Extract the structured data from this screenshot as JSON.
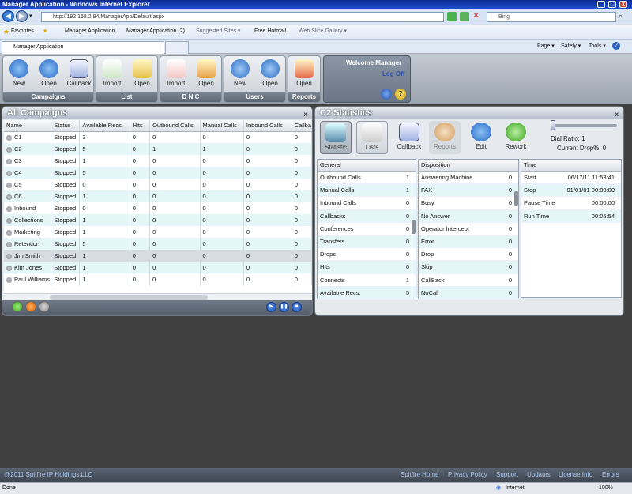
{
  "window": {
    "title": "Manager Application - Windows Internet Explorer"
  },
  "browser": {
    "url": "http://192.168.2.94/ManagerApp/Default.aspx",
    "search_placeholder": "Bing",
    "favorites": {
      "label": "Favorites",
      "items": [
        "Manager Application",
        "Manager Application (2)",
        "Suggested Sites ▾",
        "Free Hotmail",
        "Web Slice Gallery ▾"
      ]
    },
    "tab": "Manager Application",
    "commands": [
      "Page ▾",
      "Safety ▾",
      "Tools ▾"
    ]
  },
  "toolbar": {
    "groups": [
      {
        "label": "Campaigns",
        "buttons": [
          "New",
          "Open",
          "Callback"
        ]
      },
      {
        "label": "List",
        "buttons": [
          "Import",
          "Open"
        ]
      },
      {
        "label": "D N C",
        "buttons": [
          "Import",
          "Open"
        ]
      },
      {
        "label": "Users",
        "buttons": [
          "New",
          "Open"
        ]
      },
      {
        "label": "Reports",
        "buttons": [
          "Open"
        ]
      }
    ],
    "welcome": "Welcome Manager",
    "logoff": "Log Off"
  },
  "campaigns": {
    "title": "All Campaigns",
    "columns": [
      "Name",
      "Status",
      "Available Recs.",
      "Hits",
      "Outbound Calls",
      "Manual Calls",
      "Inbound Calls",
      "Callba"
    ],
    "rows": [
      [
        "C1",
        "Stopped",
        "3",
        "0",
        "0",
        "0",
        "0",
        "0"
      ],
      [
        "C2",
        "Stopped",
        "5",
        "0",
        "1",
        "1",
        "0",
        "0"
      ],
      [
        "C3",
        "Stopped",
        "1",
        "0",
        "0",
        "0",
        "0",
        "0"
      ],
      [
        "C4",
        "Stopped",
        "5",
        "0",
        "0",
        "0",
        "0",
        "0"
      ],
      [
        "C5",
        "Stopped",
        "0",
        "0",
        "0",
        "0",
        "0",
        "0"
      ],
      [
        "C6",
        "Stopped",
        "1",
        "0",
        "0",
        "0",
        "0",
        "0"
      ],
      [
        "Inbound",
        "Stopped",
        "0",
        "0",
        "0",
        "0",
        "0",
        "0"
      ],
      [
        "Collections",
        "Stopped",
        "1",
        "0",
        "0",
        "0",
        "0",
        "0"
      ],
      [
        "Marketing",
        "Stopped",
        "1",
        "0",
        "0",
        "0",
        "0",
        "0"
      ],
      [
        "Retention",
        "Stopped",
        "5",
        "0",
        "0",
        "0",
        "0",
        "0"
      ],
      [
        "Jim Smith",
        "Stopped",
        "1",
        "0",
        "0",
        "0",
        "0",
        "0"
      ],
      [
        "Kim Jones",
        "Stopped",
        "1",
        "0",
        "0",
        "0",
        "0",
        "0"
      ],
      [
        "Paul Williams",
        "Stopped",
        "1",
        "0",
        "0",
        "0",
        "0",
        "0"
      ]
    ]
  },
  "stats": {
    "title": "C2 Statistics",
    "tabs": [
      "Statistic",
      "Lists",
      "Callback",
      "Reports",
      "Edit",
      "Rework"
    ],
    "dial_ratio_label": "Dial Ratio: 1",
    "drop_label": "Current Drop%: 0",
    "general": {
      "header": "General",
      "rows": [
        [
          "Outbound Calls",
          "1"
        ],
        [
          "Manual Calls",
          "1"
        ],
        [
          "Inbound Calls",
          "0"
        ],
        [
          "Callbacks",
          "0"
        ],
        [
          "Conferences",
          "0"
        ],
        [
          "Transfers",
          "0"
        ],
        [
          "Drops",
          "0"
        ],
        [
          "Hits",
          "0"
        ],
        [
          "Connects",
          "1"
        ],
        [
          "Available Recs.",
          "5"
        ]
      ]
    },
    "disposition": {
      "header": "Disposition",
      "rows": [
        [
          "Answering Machine",
          "0"
        ],
        [
          "FAX",
          "0"
        ],
        [
          "Busy",
          "0"
        ],
        [
          "No Answer",
          "0"
        ],
        [
          "Operator Intercept",
          "0"
        ],
        [
          "Error",
          "0"
        ],
        [
          "Drop",
          "0"
        ],
        [
          "Skip",
          "0"
        ],
        [
          "CallBack",
          "0"
        ],
        [
          "NoCall",
          "0"
        ]
      ]
    },
    "time": {
      "header": "Time",
      "rows": [
        [
          "Start",
          "06/17/11 11:53:41"
        ],
        [
          "Stop",
          "01/01/01 00:00:00"
        ],
        [
          "Pause Time",
          "00:00:00"
        ],
        [
          "Run Time",
          "00:05:54"
        ]
      ]
    }
  },
  "footer": {
    "copyright": "@2011 Spitfire IP Holdings,LLC",
    "links": [
      "Spitfire Home",
      "Privacy Policy",
      "Support",
      "Updates",
      "License Info",
      "Errors"
    ]
  },
  "status": {
    "left": "Done",
    "zone": "Internet",
    "zoom": "100%"
  }
}
